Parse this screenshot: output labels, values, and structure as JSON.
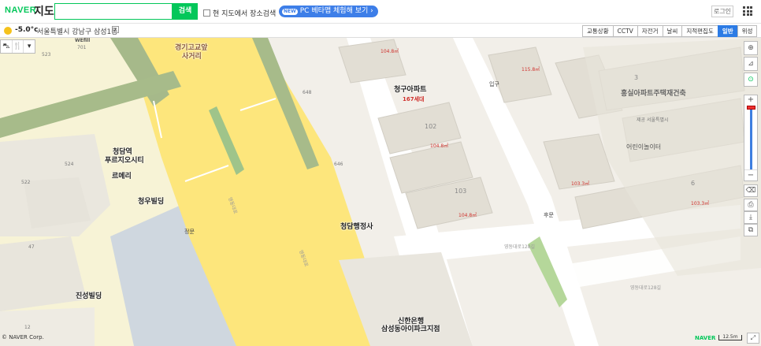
{
  "header": {
    "logo": "NAVER",
    "title": "지도",
    "search_value": "",
    "search_button": "검색",
    "checkbox_label": "현 지도에서 장소검색",
    "beta_badge": "NEW",
    "beta_label": "PC 베타맵 체험해 보기 ›",
    "login": "로그인",
    "apps_icon": "grid-icon"
  },
  "subbar": {
    "weather_icon": "sun-icon",
    "temperature": "-5.0°c",
    "location": "서울특별시 강남구 삼성1동",
    "dropdown": "▾",
    "layers": [
      {
        "label": "교통상황",
        "active": false
      },
      {
        "label": "CCTV",
        "active": false
      },
      {
        "label": "자전거",
        "active": false
      },
      {
        "label": "날씨",
        "active": false
      },
      {
        "label": "지적편집도",
        "active": false
      },
      {
        "label": "일반",
        "active": true
      },
      {
        "label": "위성",
        "active": false
      }
    ]
  },
  "map_controls": {
    "left": [
      "bus-icon",
      "restaurant-icon",
      "▾"
    ],
    "right_top": [
      "⊕",
      "⊿",
      "⊙"
    ],
    "zoom_plus": "+",
    "zoom_minus": "−",
    "right_tools": [
      "⌫",
      "⎙",
      "⤓",
      "⧉"
    ]
  },
  "labels": {
    "l1": "경기고교앞",
    "l2": "사거리",
    "l3": "청구아파트",
    "l4": "167세대",
    "l5": "102",
    "l6": "103",
    "l7": "청담역",
    "l8": "푸르지오시티",
    "l9": "르메리",
    "l10": "청우빌딩",
    "l11": "청담행정사",
    "l12": "진성빌딩",
    "l13": "신한은행",
    "l14": "삼성동아이파크지점",
    "l15": "홍실아파트주택재건축",
    "l16": "제공 서울특별시",
    "l17": "어린이놀이터",
    "l18": "입구",
    "l19": "후문",
    "l20": "정문",
    "l21": "3",
    "l22": "6",
    "l23": "WEfill",
    "l24": "104.8㎡",
    "l25": "104.8㎡",
    "l26": "115.8㎡",
    "l27": "103.3㎡",
    "l28": "103.3㎡",
    "l29": "104.8㎡",
    "l30": "영동대로128길",
    "l31": "영동대로128길",
    "l32": "영동대로",
    "l33": "영동대로",
    "l34": "524",
    "l35": "522",
    "l36": "47",
    "l37": "12",
    "l38": "648",
    "l39": "646",
    "l40": "523",
    "l41": "701"
  },
  "footer": {
    "copyright": "© NAVER Corp.",
    "brand": "NAVER",
    "scale": "12.5m",
    "corner_btn": "⤢"
  }
}
